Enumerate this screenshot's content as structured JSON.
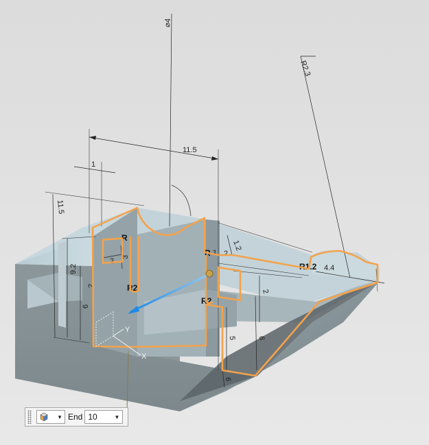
{
  "dimensions": {
    "diameter": "⌀4",
    "radius_large": "R2.3",
    "length_top": "11.5",
    "height_left": "11.5",
    "thickness": "1",
    "height_inner": "9.2",
    "left_2": "2",
    "left_6": "6",
    "pocket_w": "2",
    "pocket_h": "3",
    "r_left": "R",
    "r_2_left": "R2",
    "r_mid": "R",
    "r_mid_small": "1",
    "r_2_mid": "R2",
    "mid_2": "2",
    "mid_1_2": "1.2",
    "right_2": "2",
    "right_5": "5",
    "right_6": "6",
    "right_6_lower": "6",
    "r_right": "R1.2",
    "right_4_4": "4.4"
  },
  "axes": {
    "y": "Y",
    "x": "X"
  },
  "toolbar": {
    "end_label": "End",
    "end_value": "10"
  },
  "icons": {
    "type": "cube-icon",
    "caret": "▼"
  },
  "colors": {
    "sketch": "#f4a24a",
    "direction": "#1e88e5"
  }
}
